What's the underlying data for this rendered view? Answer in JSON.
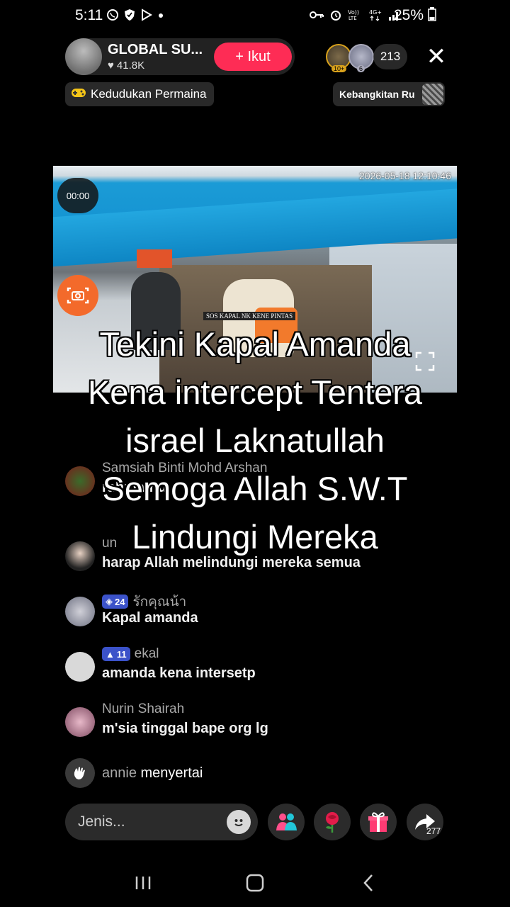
{
  "status_bar": {
    "time": "5:11",
    "battery": "25%",
    "left_icons": [
      "whatsapp-icon",
      "shield-icon",
      "play-store-icon",
      "dot"
    ],
    "right_icons": [
      "key-icon",
      "alarm-icon",
      "volte-icon",
      "4g-icon",
      "signal-icon"
    ]
  },
  "header": {
    "host_name": "GLOBAL SU...",
    "likes": "41.8K",
    "follow_label": "+ Ikut",
    "viewer_rank_1": "10+",
    "viewer_rank_2": "6",
    "viewer_count": "213",
    "close_symbol": "✕"
  },
  "chips": {
    "game_label": "Kedudukan Permaina",
    "ranking_label": "Kebangkitan Ru"
  },
  "video": {
    "timestamp": "2026-05-18 12:10:46",
    "timer": "00:00",
    "banner_text": "SOS KAPAL NK KENE PINTAS"
  },
  "overlay": {
    "lines": [
      "Tekini Kapal Amanda",
      "Kena intercept Tentera",
      "israel Laknatullah",
      "Semoga Allah S.W.T",
      "Lindungi Mereka"
    ]
  },
  "comments": [
    {
      "name": "Samsiah Binti Mohd Arshan",
      "text": "rahmatnu",
      "badge": ""
    },
    {
      "name": "un",
      "text": "harap Allah melindungi mereka semua",
      "badge": ""
    },
    {
      "name": "รักคุณน้า",
      "text": "Kapal amanda",
      "badge": "24"
    },
    {
      "name": "ekal",
      "text": "amanda kena intersetp",
      "badge": "11"
    },
    {
      "name": "Nurin Shairah",
      "text": "m'sia tinggal bape org lg",
      "badge": ""
    }
  ],
  "join": {
    "name": "annie",
    "action": "menyertai"
  },
  "bottom_bar": {
    "input_placeholder": "Jenis...",
    "share_count": "277"
  },
  "colors": {
    "accent": "#fe2c55",
    "badge_blue": "#3b52c9",
    "screenshot_orange": "#f36a2b"
  }
}
